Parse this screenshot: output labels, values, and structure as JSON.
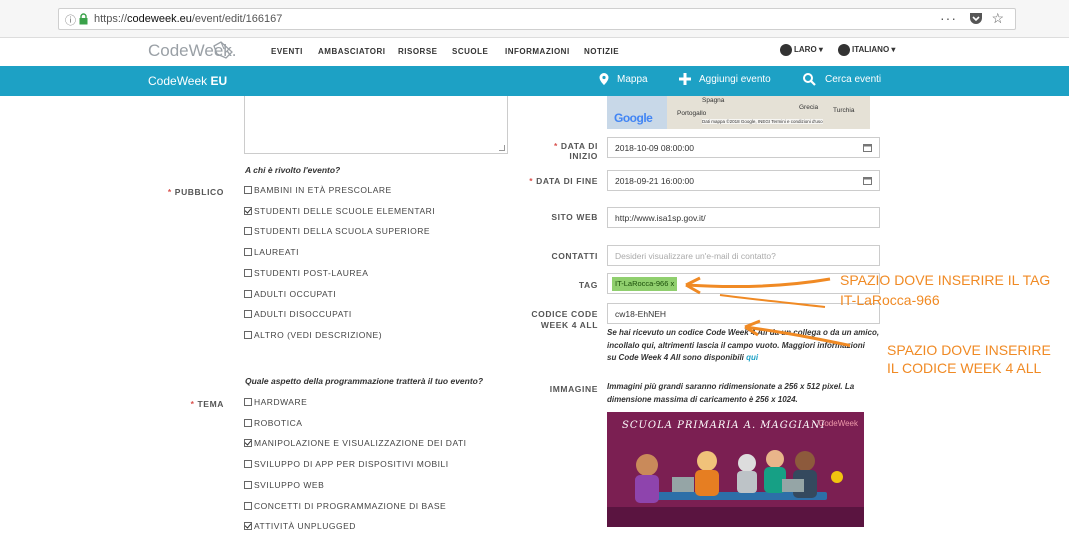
{
  "browser": {
    "url_prefix": "https://",
    "url_domain": "codeweek.eu",
    "url_path": "/event/edit/166167",
    "info_glyph": "ⓘ",
    "menu_dots": "···",
    "star_glyph": "☆"
  },
  "header": {
    "logo": "CodeWeek.",
    "nav": [
      "EVENTI",
      "AMBASCIATORI",
      "RISORSE",
      "SCUOLE",
      "INFORMAZIONI",
      "NOTIZIE"
    ],
    "user": "LARO ▾",
    "language": "ITALIANO ▾"
  },
  "teal_bar": {
    "brand_light": "CodeWeek ",
    "brand_bold": "EU",
    "map": "Mappa",
    "add_event": "Aggiungi evento",
    "search_events": "Cerca eventi"
  },
  "map": {
    "labels": [
      "Spagna",
      "Grecia",
      "Turchia",
      "Portogallo"
    ],
    "google": "Google",
    "credit": "Dati mappa ©2018 Google, INEGI   Termini e condizioni d'uso"
  },
  "public": {
    "label": "PUBBLICO",
    "question": "A chi è rivolto l'evento?",
    "options": [
      {
        "label": "BAMBINI IN ETÀ PRESCOLARE",
        "checked": false
      },
      {
        "label": "STUDENTI DELLE SCUOLE ELEMENTARI",
        "checked": true
      },
      {
        "label": "STUDENTI DELLA SCUOLA SUPERIORE",
        "checked": false
      },
      {
        "label": "LAUREATI",
        "checked": false
      },
      {
        "label": "STUDENTI POST-LAUREA",
        "checked": false
      },
      {
        "label": "ADULTI OCCUPATI",
        "checked": false
      },
      {
        "label": "ADULTI DISOCCUPATI",
        "checked": false
      },
      {
        "label": "ALTRO (VEDI DESCRIZIONE)",
        "checked": false
      }
    ]
  },
  "theme": {
    "label": "TEMA",
    "question": "Quale aspetto della programmazione tratterà il tuo evento?",
    "options": [
      {
        "label": "HARDWARE",
        "checked": false
      },
      {
        "label": "ROBOTICA",
        "checked": false
      },
      {
        "label": "MANIPOLAZIONE E VISUALIZZAZIONE DEI DATI",
        "checked": true
      },
      {
        "label": "SVILUPPO DI APP PER DISPOSITIVI MOBILI",
        "checked": false
      },
      {
        "label": "SVILUPPO WEB",
        "checked": false
      },
      {
        "label": "CONCETTI DI PROGRAMMAZIONE DI BASE",
        "checked": false
      },
      {
        "label": "ATTIVITÀ UNPLUGGED",
        "checked": true
      }
    ]
  },
  "fields": {
    "start_label_1": "DATA DI",
    "start_label_2": "INIZIO",
    "start_value": "2018-10-09 08:00:00",
    "end_label": "DATA DI FINE",
    "end_value": "2018-09-21 16:00:00",
    "website_label": "SITO WEB",
    "website_value": "http://www.isa1sp.gov.it/",
    "contacts_label": "CONTATTI",
    "contacts_placeholder": "Desideri visualizzare un'e-mail di contatto?",
    "tag_label": "TAG",
    "tag_value": "IT-LaRocca-966 x",
    "code_label_1": "CODICE CODE",
    "code_label_2": "WEEK 4 ALL",
    "code_value": "cw18-EhNEH",
    "code_help_1": "Se hai ricevuto un codice Code Week 4 All da un collega o da un amico,",
    "code_help_2": "incollalo qui, altrimenti lascia il campo vuoto. Maggiori informazioni",
    "code_help_3": "su Code Week 4 All sono disponibili ",
    "code_help_link": "qui",
    "image_label": "IMMAGINE",
    "image_help_1": "Immagini più grandi saranno ridimensionate a 256 x 512 pixel. La",
    "image_help_2": "dimensione massima di caricamento è 256 x 1024.",
    "poster_title": "SCUOLA PRIMARIA A. MAGGIANI",
    "poster_logo": "CodeWeek"
  },
  "annotations": {
    "tag_note_1": "SPAZIO DOVE INSERIRE IL TAG",
    "tag_note_2": "IT-LaRocca-966",
    "code_note_1": "SPAZIO DOVE INSERIRE",
    "code_note_2": "IL CODICE  WEEK 4 ALL"
  },
  "colors": {
    "teal": "#1da1c5",
    "annotation": "#f08a24",
    "tag_chip": "#90cf6e",
    "poster_bg": "#7b1f52"
  }
}
